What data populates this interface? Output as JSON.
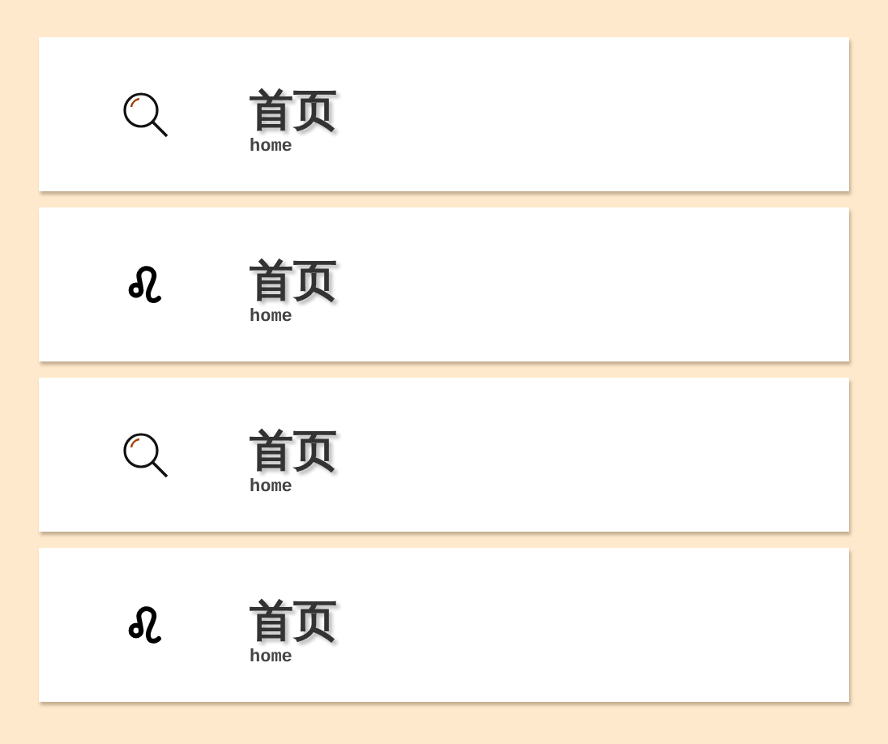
{
  "items": [
    {
      "kind": "search",
      "title": "首页",
      "subtitle": "home"
    },
    {
      "kind": "leo",
      "title": "首页",
      "subtitle": "home"
    },
    {
      "kind": "search",
      "title": "首页",
      "subtitle": "home"
    },
    {
      "kind": "leo",
      "title": "首页",
      "subtitle": "home"
    }
  ]
}
